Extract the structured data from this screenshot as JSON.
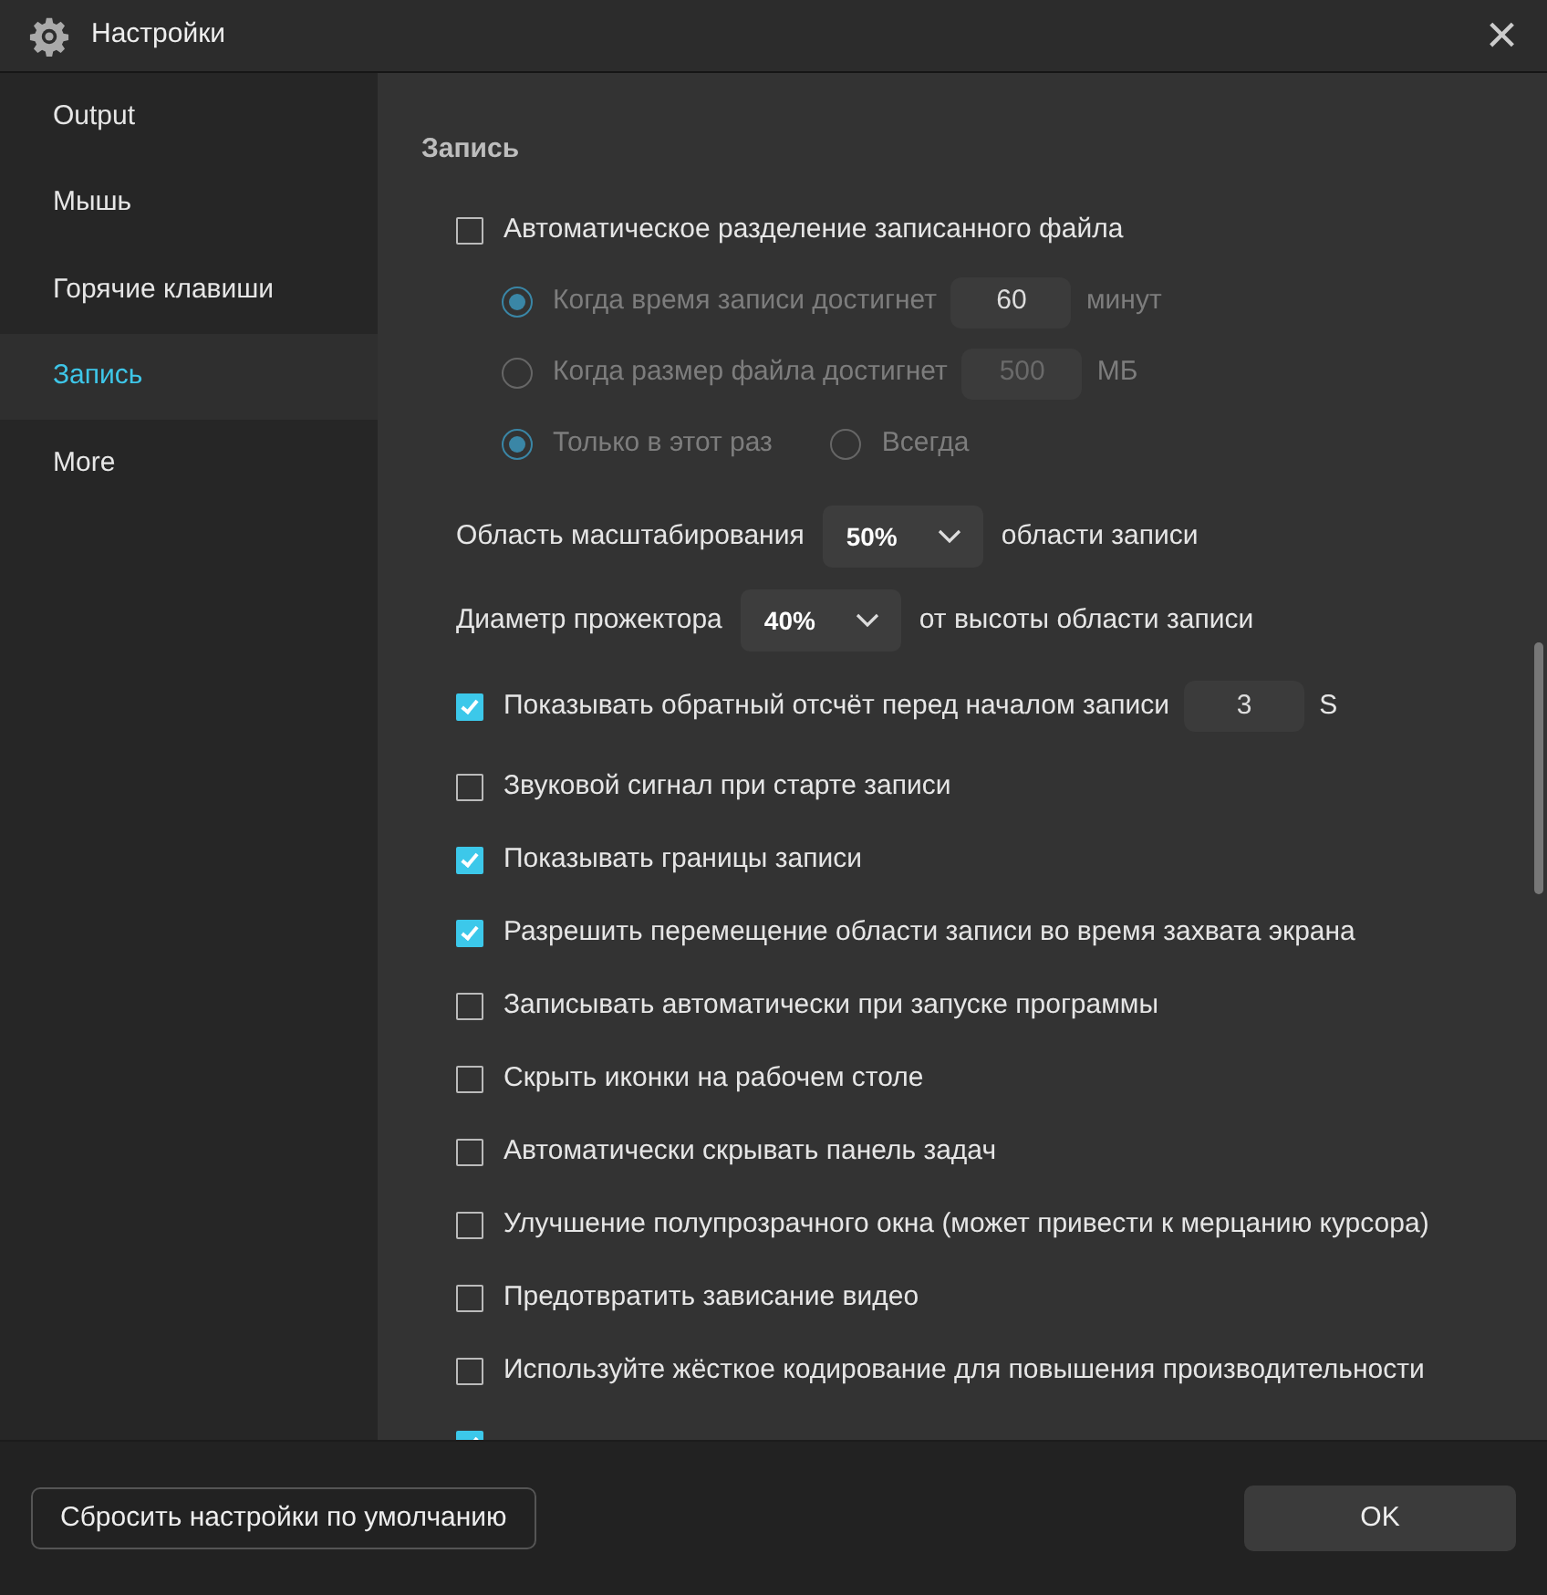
{
  "window": {
    "title": "Настройки",
    "close": "×"
  },
  "sidebar": {
    "items": [
      {
        "label": "Output",
        "selected": false
      },
      {
        "label": "Мышь",
        "selected": false
      },
      {
        "label": "Горячие клавиши",
        "selected": false
      },
      {
        "label": "Запись",
        "selected": true
      },
      {
        "label": "More",
        "selected": false
      }
    ]
  },
  "section": {
    "title": "Запись",
    "settings": [
      {
        "kind": "checkbox",
        "label": "Автоматическое разделение записанного файла",
        "checked": false
      },
      {
        "kind": "radios",
        "disabled": true,
        "options": [
          {
            "label": "Когда время записи достигнет",
            "selected": true,
            "value": "60",
            "unit": "минут"
          }
        ]
      },
      {
        "kind": "radios",
        "disabled": true,
        "options": [
          {
            "label": "Когда размер файла достигнет",
            "selected": false,
            "value": "500",
            "unit": "МБ"
          }
        ]
      },
      {
        "kind": "radios",
        "disabled": true,
        "options": [
          {
            "label": "Только в этот раз",
            "selected": true
          },
          {
            "label": "Всегда",
            "selected": false
          }
        ]
      },
      {
        "kind": "dropdown",
        "label": "Область масштабирования",
        "value": "50%",
        "suffix": "области записи"
      },
      {
        "kind": "dropdown",
        "label": "Диаметр прожектора",
        "value": "40%",
        "suffix": "от высоты области записи"
      },
      {
        "kind": "checkbox",
        "label": "Показывать обратный отсчёт перед началом записи",
        "checked": true,
        "value": "3",
        "unit": "S"
      },
      {
        "kind": "checkbox",
        "label": "Звуковой сигнал при старте записи",
        "checked": false
      },
      {
        "kind": "checkbox",
        "label": "Показывать границы записи",
        "checked": true
      },
      {
        "kind": "checkbox",
        "label": "Разрешить перемещение области записи во время захвата экрана",
        "checked": true
      },
      {
        "kind": "checkbox",
        "label": "Записывать автоматически при запуске программы",
        "checked": false
      },
      {
        "kind": "checkbox",
        "label": "Скрыть иконки на рабочем столе",
        "checked": false
      },
      {
        "kind": "checkbox",
        "label": "Автоматически скрывать панель задач",
        "checked": false
      },
      {
        "kind": "checkbox",
        "label": "Улучшение полупрозрачного окна (может привести к мерцанию курсора)",
        "checked": false
      },
      {
        "kind": "checkbox",
        "label": "Предотвратить зависание видео",
        "checked": false
      },
      {
        "kind": "checkbox",
        "label": "Используйте жёсткое кодирование для повышения производительности",
        "checked": false
      },
      {
        "kind": "checkbox",
        "checked": true
      }
    ]
  },
  "footer": {
    "buttons": [
      "Сбросить настройки по умолчанию",
      "OK"
    ]
  }
}
